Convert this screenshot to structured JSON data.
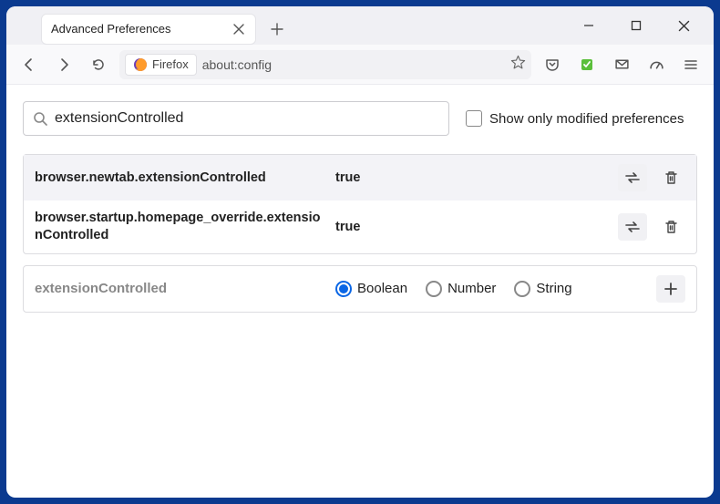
{
  "window": {
    "title": "Advanced Preferences"
  },
  "address": {
    "brand": "Firefox",
    "url": "about:config"
  },
  "search": {
    "value": "extensionControlled",
    "show_modified_label": "Show only modified preferences"
  },
  "prefs": [
    {
      "name": "browser.newtab.extensionControlled",
      "value": "true"
    },
    {
      "name": "browser.startup.homepage_override.extensionControlled",
      "value": "true"
    }
  ],
  "new_pref": {
    "name": "extensionControlled",
    "types": {
      "boolean": "Boolean",
      "number": "Number",
      "string": "String"
    },
    "selected": "boolean"
  }
}
